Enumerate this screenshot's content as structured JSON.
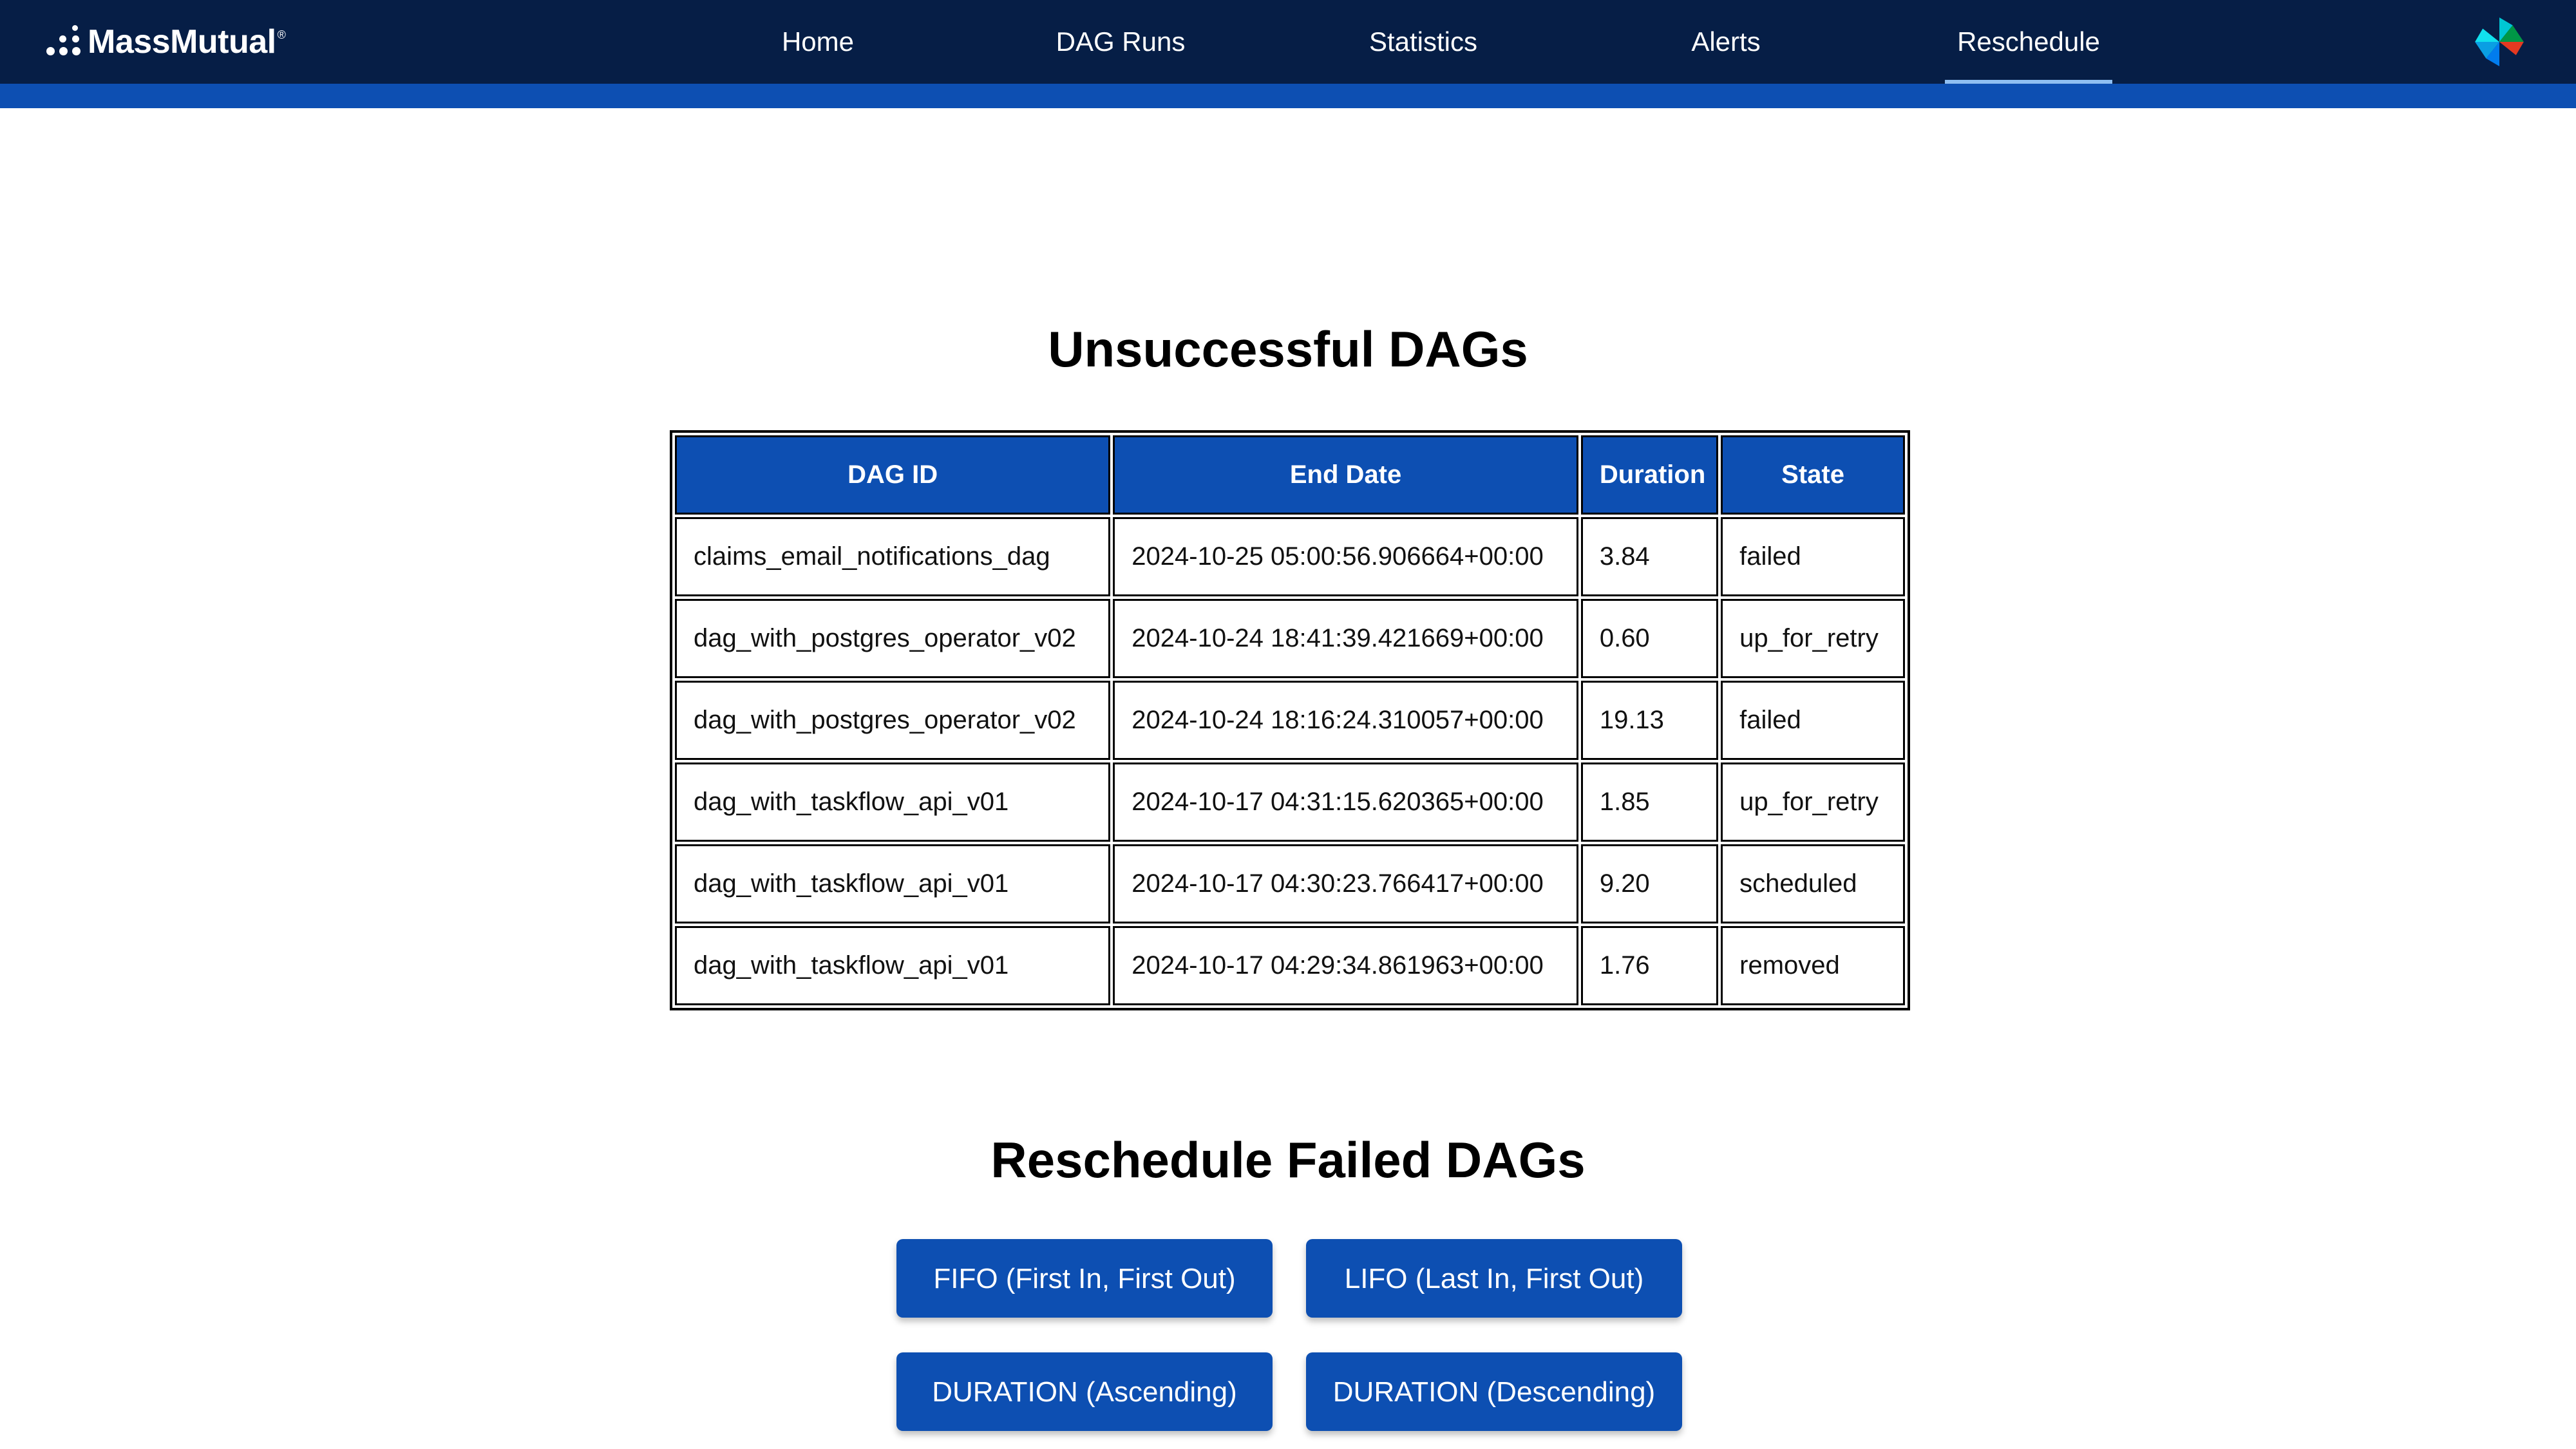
{
  "brand": {
    "name": "MassMutual",
    "reg": "®"
  },
  "nav": {
    "items": [
      {
        "label": "Home"
      },
      {
        "label": "DAG Runs"
      },
      {
        "label": "Statistics"
      },
      {
        "label": "Alerts"
      },
      {
        "label": "Reschedule"
      }
    ],
    "active": "Reschedule"
  },
  "colors": {
    "navbar": "#061e46",
    "accent": "#0d4fb2",
    "active_underline": "#8fbff2"
  },
  "icons": {
    "top_right": "airflow-pinwheel-icon"
  },
  "unsuccessful": {
    "title": "Unsuccessful DAGs",
    "columns": [
      "DAG ID",
      "End Date",
      "Duration",
      "State"
    ],
    "rows": [
      [
        "claims_email_notifications_dag",
        "2024-10-25 05:00:56.906664+00:00",
        "3.84",
        "failed"
      ],
      [
        "dag_with_postgres_operator_v02",
        "2024-10-24 18:41:39.421669+00:00",
        "0.60",
        "up_for_retry"
      ],
      [
        "dag_with_postgres_operator_v02",
        "2024-10-24 18:16:24.310057+00:00",
        "19.13",
        "failed"
      ],
      [
        "dag_with_taskflow_api_v01",
        "2024-10-17 04:31:15.620365+00:00",
        "1.85",
        "up_for_retry"
      ],
      [
        "dag_with_taskflow_api_v01",
        "2024-10-17 04:30:23.766417+00:00",
        "9.20",
        "scheduled"
      ],
      [
        "dag_with_taskflow_api_v01",
        "2024-10-17 04:29:34.861963+00:00",
        "1.76",
        "removed"
      ]
    ]
  },
  "reschedule": {
    "title": "Reschedule Failed DAGs",
    "fifo": "FIFO (First In, First Out)",
    "lifo": "LIFO (Last In, First Out)",
    "duration_asc": "DURATION (Ascending)",
    "duration_desc": "DURATION (Descending)"
  }
}
